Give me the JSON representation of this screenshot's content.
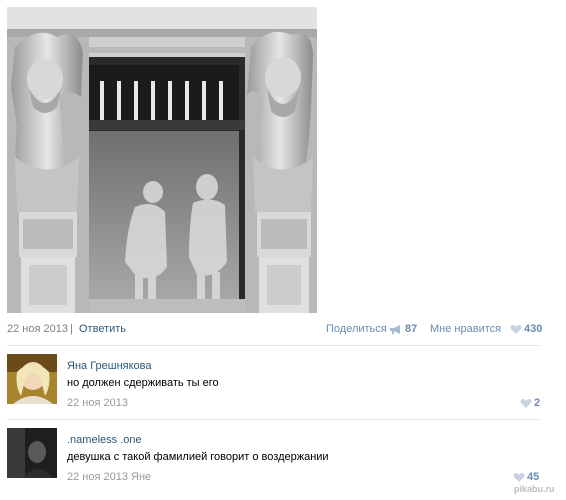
{
  "post": {
    "photo_alt": "photo",
    "date": "22 ноя 2013",
    "separator": "|",
    "reply_label": "Ответить",
    "share_label": "Поделиться",
    "share_count": "87",
    "like_label": "Мне нравится",
    "like_count": "430"
  },
  "comments": [
    {
      "author": "Яна Грешнякова",
      "text": "но должен сдерживать ты его",
      "date": "22 ноя 2013",
      "likes": "2"
    },
    {
      "author": ".nameless .one",
      "text": "девушка с такой фамилией говорит о воздержании",
      "date": "22 ноя 2013 Яне",
      "likes": "45"
    }
  ],
  "watermark": "pikabu.ru",
  "colors": {
    "link": "#2b587a",
    "meta_blue": "#6a8bb0",
    "muted": "#999999",
    "divider": "#e4e8ed"
  },
  "icons": {
    "share": "megaphone-icon",
    "like": "heart-icon"
  }
}
